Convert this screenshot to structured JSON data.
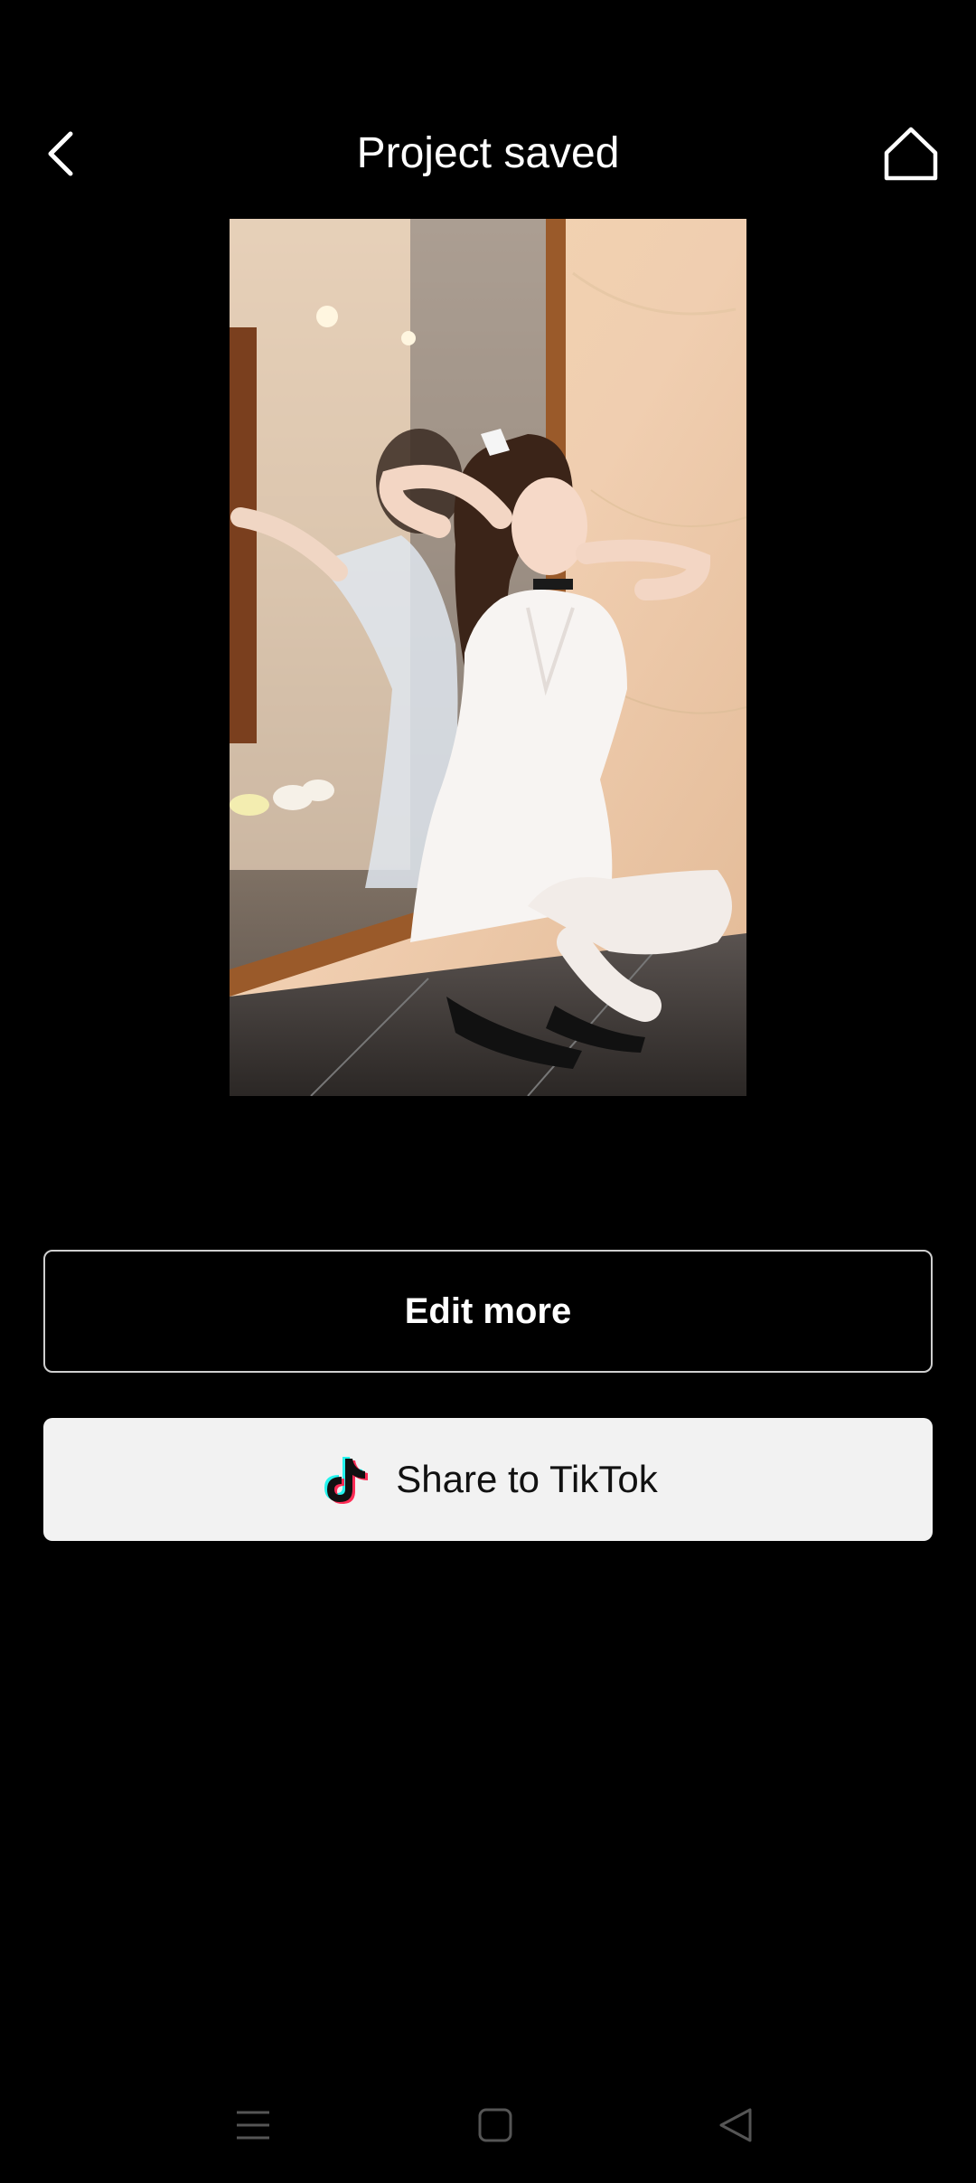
{
  "header": {
    "title": "Project saved",
    "back_icon": "chevron-left-icon",
    "home_icon": "home-icon"
  },
  "preview": {
    "description_icon": "video-preview-image"
  },
  "actions": {
    "edit_label": "Edit more",
    "share_label": "Share to TikTok",
    "share_icon": "tiktok-icon"
  },
  "colors": {
    "background": "#000000",
    "share_button_bg": "#f2f2f2",
    "edit_button_border": "#cfcfcf",
    "tiktok_cyan": "#25f4ee",
    "tiktok_red": "#fe2c55"
  },
  "system_nav": {
    "menu_icon": "menu-icon",
    "home_icon": "square-home-icon",
    "back_icon": "triangle-back-icon"
  }
}
